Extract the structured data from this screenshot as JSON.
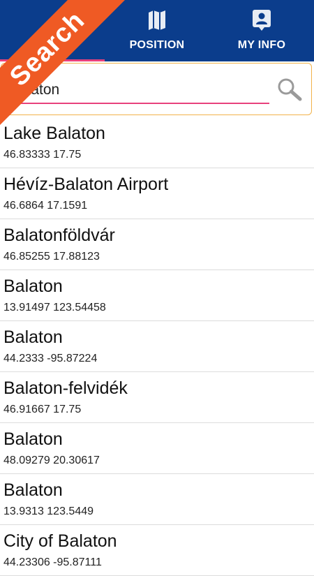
{
  "tabs": [
    {
      "label": "SEARCH",
      "icon": "search-tab-icon"
    },
    {
      "label": "POSITION",
      "icon": "map-icon"
    },
    {
      "label": "MY INFO",
      "icon": "contact-card-icon"
    }
  ],
  "ribbon": {
    "label": "Search",
    "color": "#ef5a24"
  },
  "search": {
    "value": "Balaton",
    "placeholder": ""
  },
  "colors": {
    "tabbar": "#0b3d8c",
    "accent": "#e8417c",
    "search_border": "#f2b24a"
  },
  "results": [
    {
      "name": "Lake Balaton",
      "coords": "46.83333 17.75"
    },
    {
      "name": "Hévíz-Balaton Airport",
      "coords": "46.6864 17.1591"
    },
    {
      "name": "Balatonföldvár",
      "coords": "46.85255 17.88123"
    },
    {
      "name": "Balaton",
      "coords": "13.91497 123.54458"
    },
    {
      "name": "Balaton",
      "coords": "44.2333 -95.87224"
    },
    {
      "name": "Balaton-felvidék",
      "coords": "46.91667 17.75"
    },
    {
      "name": "Balaton",
      "coords": "48.09279 20.30617"
    },
    {
      "name": "Balaton",
      "coords": "13.9313 123.5449"
    },
    {
      "name": "City of Balaton",
      "coords": "44.23306 -95.87111"
    }
  ]
}
